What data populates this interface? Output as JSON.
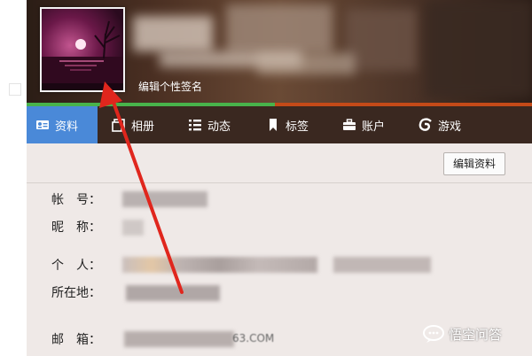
{
  "header": {
    "signature_label": "编辑个性签名"
  },
  "nav": {
    "tabs": [
      {
        "label": "资料",
        "icon": "id-card-icon",
        "active": true
      },
      {
        "label": "相册",
        "icon": "photo-album-icon",
        "active": false
      },
      {
        "label": "动态",
        "icon": "list-icon",
        "active": false
      },
      {
        "label": "标签",
        "icon": "bookmark-icon",
        "active": false
      },
      {
        "label": "账户",
        "icon": "briefcase-icon",
        "active": false
      },
      {
        "label": "游戏",
        "icon": "game-swirl-icon",
        "active": false
      }
    ]
  },
  "profile": {
    "edit_button": "编辑资料",
    "fields": {
      "account": "帐　号：",
      "nickname": "昵　称：",
      "personal": "个　人：",
      "location": "所在地：",
      "email": "邮　箱："
    },
    "email_suffix": "63.COM"
  },
  "colors": {
    "active_tab": "#4a89d8",
    "nav_bg": "#3a2820",
    "progress_green": "#48b34b",
    "progress_orange": "#c44a18",
    "arrow": "#e0261d"
  },
  "watermark": {
    "text": "悟空问答"
  }
}
